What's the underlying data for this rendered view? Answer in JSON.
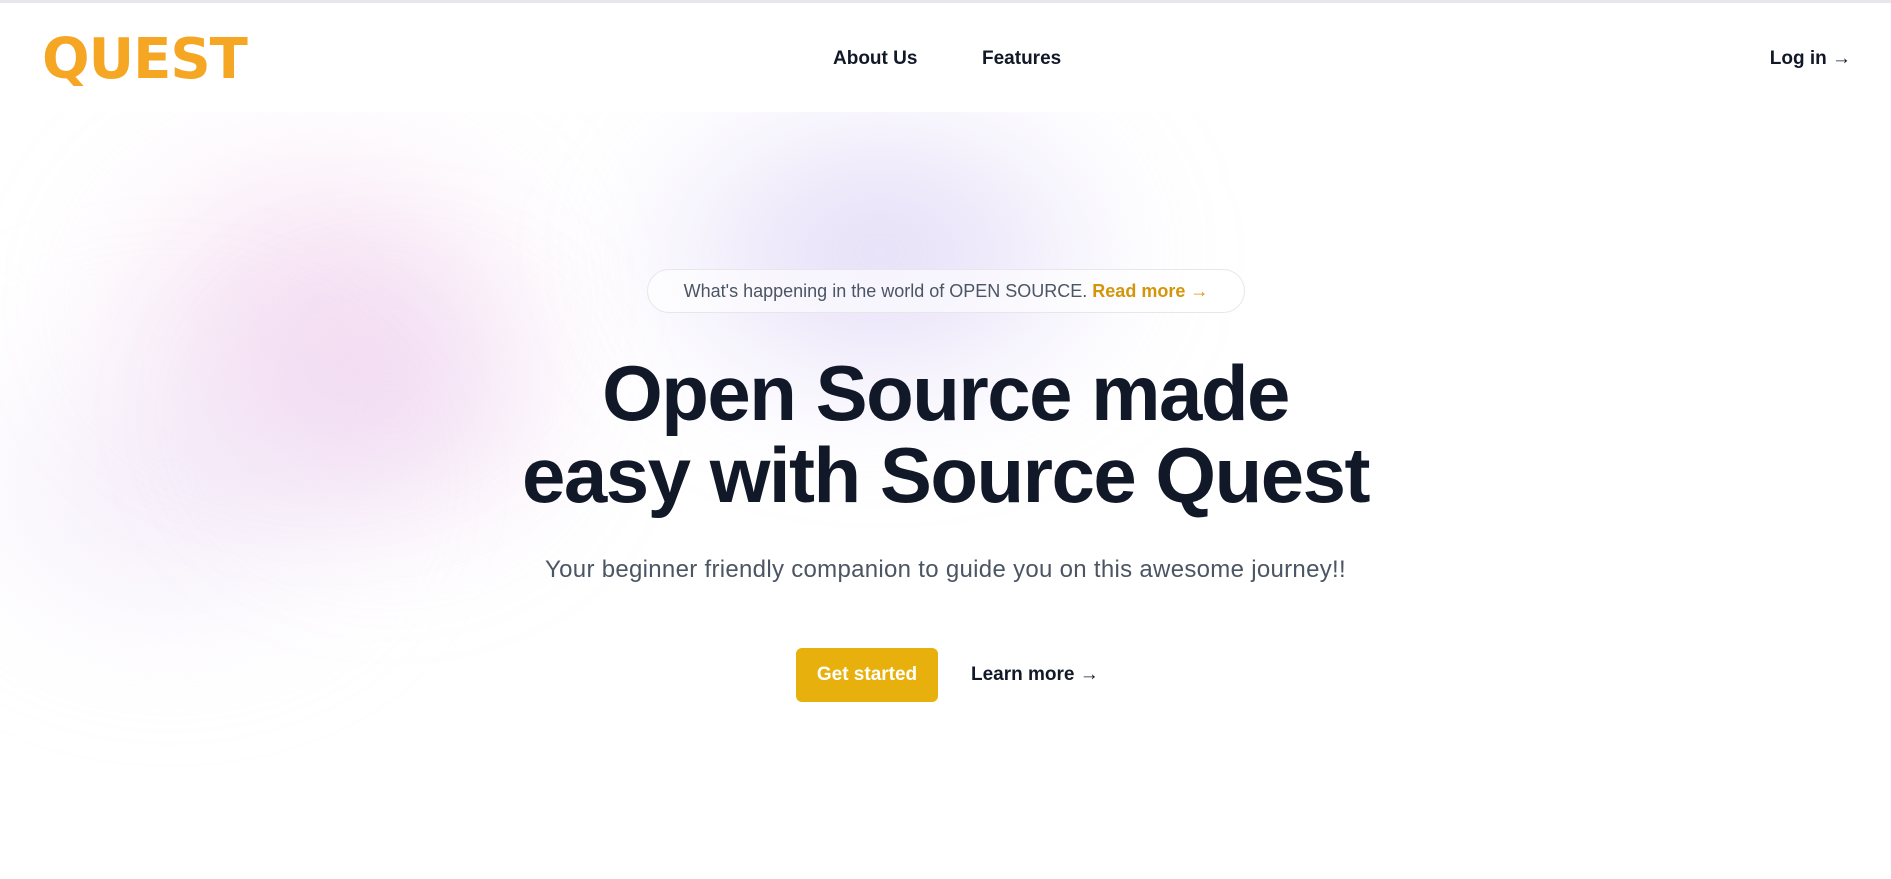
{
  "header": {
    "logo_text": "QUEST",
    "nav": [
      {
        "label": "About Us"
      },
      {
        "label": "Features"
      }
    ],
    "login_label": "Log in →"
  },
  "announcement": {
    "text": "What's happening in the world of OPEN SOURCE.",
    "link_label": "Read more →"
  },
  "hero": {
    "headline_line1": "Open Source made",
    "headline_line2": "easy with Source Quest",
    "subheadline": "Your beginner friendly companion to guide you on this awesome journey!!",
    "primary_cta": "Get started",
    "secondary_cta": "Learn more →"
  },
  "colors": {
    "brand": "#f5a623",
    "cta": "#e8b00c",
    "link_accent": "#d4950a",
    "text": "#111827",
    "muted": "#4b5563"
  }
}
